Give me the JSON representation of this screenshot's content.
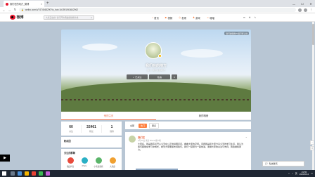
{
  "browser": {
    "tab_title": "我们在的地方_微博",
    "url": "weibo.com/u/7474048290?is_hot=1#1591943642962",
    "new_tab": "+",
    "win_min": "—",
    "win_max": "☐",
    "win_close": "✕"
  },
  "weibo_nav": {
    "logo": "微博",
    "search_placeholder": "大家正在搜: 请打开防晒霜抵挡紫外线",
    "menu": [
      {
        "icon": "⌂",
        "label": "首页"
      },
      {
        "icon": "▶",
        "label": "视频"
      },
      {
        "icon": "◎",
        "label": "发现"
      },
      {
        "icon": "♟",
        "label": "游戏"
      },
      {
        "icon": "☺",
        "label": "喵喵"
      }
    ],
    "right": [
      "✉",
      "⚙",
      "✎"
    ]
  },
  "profile": {
    "vip_tag": "我们的微博PC版已经上线",
    "name": "我们在的地方",
    "bio": "简介: 我们在的地方",
    "follow_label": "已关注",
    "message_label": "私信",
    "more_label": "≡",
    "tabs": [
      "他的主页",
      "我的相册"
    ]
  },
  "stats": [
    {
      "num": "60",
      "label": "关注"
    },
    {
      "num": "32461",
      "label": "粉丝"
    },
    {
      "num": "1",
      "label": "微博"
    }
  ],
  "fan_title": "粉丝团",
  "group_title": "关注的群聊",
  "groups": [
    {
      "label": "稻田抖音",
      "color": "#e84b3c"
    },
    {
      "label": "iParty",
      "color": "#2ab0c5"
    },
    {
      "label": "小家庭观察",
      "color": "#5bb56a"
    },
    {
      "label": "大家庭",
      "color": "#f0a030"
    }
  ],
  "feed_tabs": [
    "全部",
    "热门",
    "更多"
  ],
  "post": {
    "name": "我们在",
    "meta": "6月 10日 来自 iPhone客户端",
    "menu": "⌄",
    "text": "大家好，我是我有点开心今天在公正地说明评评，看看大家的空闲。问题我是和大家分享今天的学习生活，我认为我们都能在学习中成长，希望大家能够支持我们，我们一起努力一起前进，谢谢大家的关注与支持，我会继续努力。"
  },
  "chat_label": "私信聊天",
  "play": "▶",
  "taskbar": {
    "time": "21:55",
    "date": "2020/6/12",
    "lang": "英"
  }
}
